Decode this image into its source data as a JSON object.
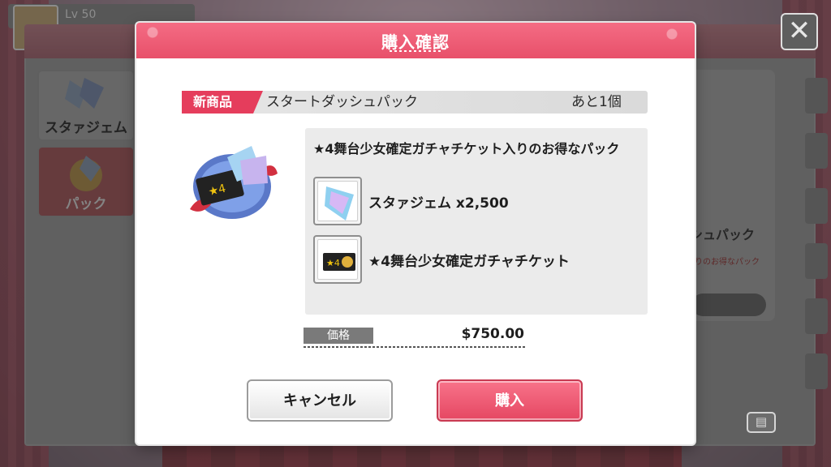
{
  "background": {
    "level_label": "Lv 50",
    "categories": [
      {
        "label": "スタァジェム"
      },
      {
        "label": "パック"
      }
    ],
    "card_title": "シュパック",
    "card_subtitle": "入りのお得なパック",
    "close_glyph": "✕",
    "list_glyph": "▤"
  },
  "modal": {
    "title": "購入確認",
    "badge": "新商品",
    "product_name": "スタートダッシュパック",
    "remaining": "あと1個",
    "description": "★4舞台少女確定ガチャチケット入りのお得なパック",
    "items": [
      {
        "name": "スタァジェム  x2,500",
        "icon": "star-gem-icon"
      },
      {
        "name": "★4舞台少女確定ガチャチケット",
        "icon": "gacha-ticket-icon"
      }
    ],
    "price_label": "価格",
    "price_value": "$750.00",
    "cancel_label": "キャンセル",
    "buy_label": "購入"
  },
  "colors": {
    "accent": "#e8506a",
    "badge": "#e53d5c"
  }
}
